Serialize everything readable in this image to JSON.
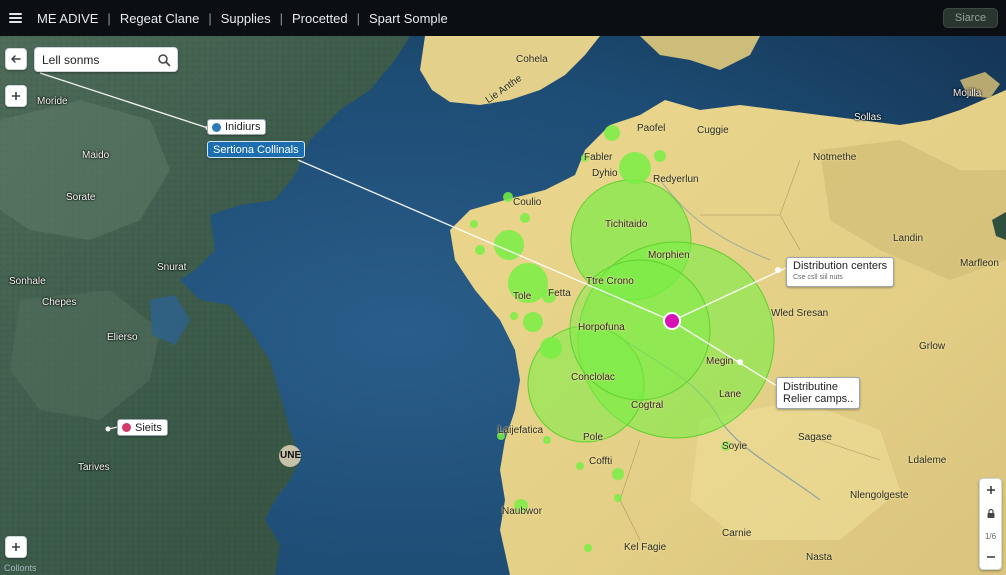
{
  "topbar": {
    "breadcrumbs": [
      "ME ADIVE",
      "Regeat Clane",
      "Supplies",
      "Procetted",
      "Spart Somple"
    ],
    "right_button": "Siarce"
  },
  "search": {
    "value": "Lell sonms"
  },
  "callouts": {
    "inidiurs": "Inidiurs",
    "sertiona": "Sertiona Collinals",
    "sieits": "Sieits",
    "distribution_centers": "Distribution centers",
    "distribution_centers_sub": "Cse csll siil nuts",
    "relief_line1": "Distributine",
    "relief_line2": "Relier camps.."
  },
  "places": {
    "moride": "Moride",
    "maido": "Maido",
    "sorate": "Sorate",
    "snurat": "Snurat",
    "sonhale": "Sonhale",
    "chepes": "Chepes",
    "elierso": "Elierso",
    "tarives": "Tarives",
    "une": "UNE",
    "cohela": "Cohela",
    "lie_anthe": "Lie Anthe",
    "paofel": "Paofel",
    "cuggie": "Cuggie",
    "mojilla": "Mojilla",
    "sollas": "Sollas",
    "fabler": "Fabler",
    "dyhio": "Dyhio",
    "redyerlun": "Redyerlun",
    "notmethe": "Notmethe",
    "coulio": "Coulio",
    "tichitaido": "Tichitaido",
    "morphien": "Morphien",
    "landin": "Landin",
    "marfleon": "Marfleon",
    "tole": "Tole",
    "fetta": "Fetta",
    "ttre_crono": "Ttre Crono",
    "wled_sresan": "Wled Sresan",
    "horpofuna": "Horpofuna",
    "growe": "Grlow",
    "megin": "Megin",
    "conclolac": "Conclolac",
    "lane": "Lane",
    "cogtral": "Cogtral",
    "laijefatica": "Laijefatica",
    "pole": "Pole",
    "soyie": "Soyie",
    "sagase": "Sagase",
    "coffti": "Coffti",
    "ldaleme": "Ldaleme",
    "naubwor": "Naubwor",
    "nlengolgeste": "Nlengolgeste",
    "carnie": "Carnie",
    "kel_fagie": "Kel Fagie",
    "nasta": "Nasta"
  },
  "zoom": {
    "label": "1/6"
  },
  "credits": "Collonts",
  "colors": {
    "ocean": "#1d4c74",
    "land_west": "#3b5a49",
    "land_east": "#e4cf86",
    "coverage": "#78ee44",
    "hub": "#d812b5"
  },
  "icons": [
    "hamburger-icon",
    "back-arrow-icon",
    "plus-icon",
    "search-icon",
    "minus-icon",
    "lock-icon"
  ]
}
